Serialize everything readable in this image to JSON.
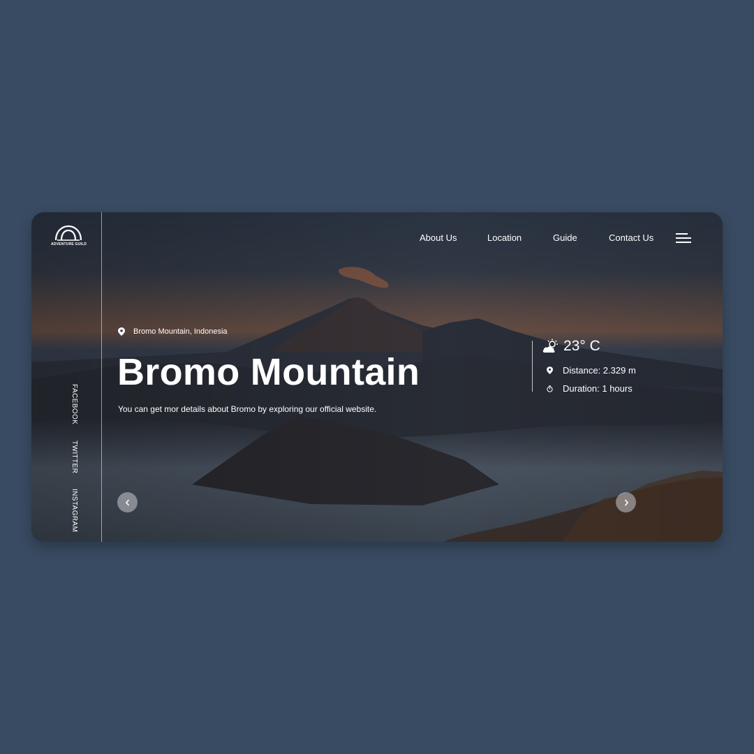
{
  "brand": {
    "logo_text": "ADVENTURE GUILD"
  },
  "nav": {
    "items": [
      "About Us",
      "Location",
      "Guide",
      "Contact Us"
    ],
    "menu_icon": "hamburger-menu-icon"
  },
  "social": {
    "items": [
      "FACEBOOK",
      "TWITTER",
      "INSTAGRAM"
    ]
  },
  "hero": {
    "location": "Bromo Mountain, Indonesia",
    "title": "Bromo Mountain",
    "description": "You can get mor details about Bromo by exploring our official website."
  },
  "info": {
    "temperature": "23° C",
    "distance": "Distance: 2.329 m",
    "duration": "Duration: 1 hours",
    "weather_icon": "partly-cloudy-icon"
  },
  "carousel": {
    "prev_icon": "chevron-left-icon",
    "next_icon": "chevron-right-icon"
  },
  "colors": {
    "page_background": "#394b62",
    "text": "#ffffff"
  }
}
